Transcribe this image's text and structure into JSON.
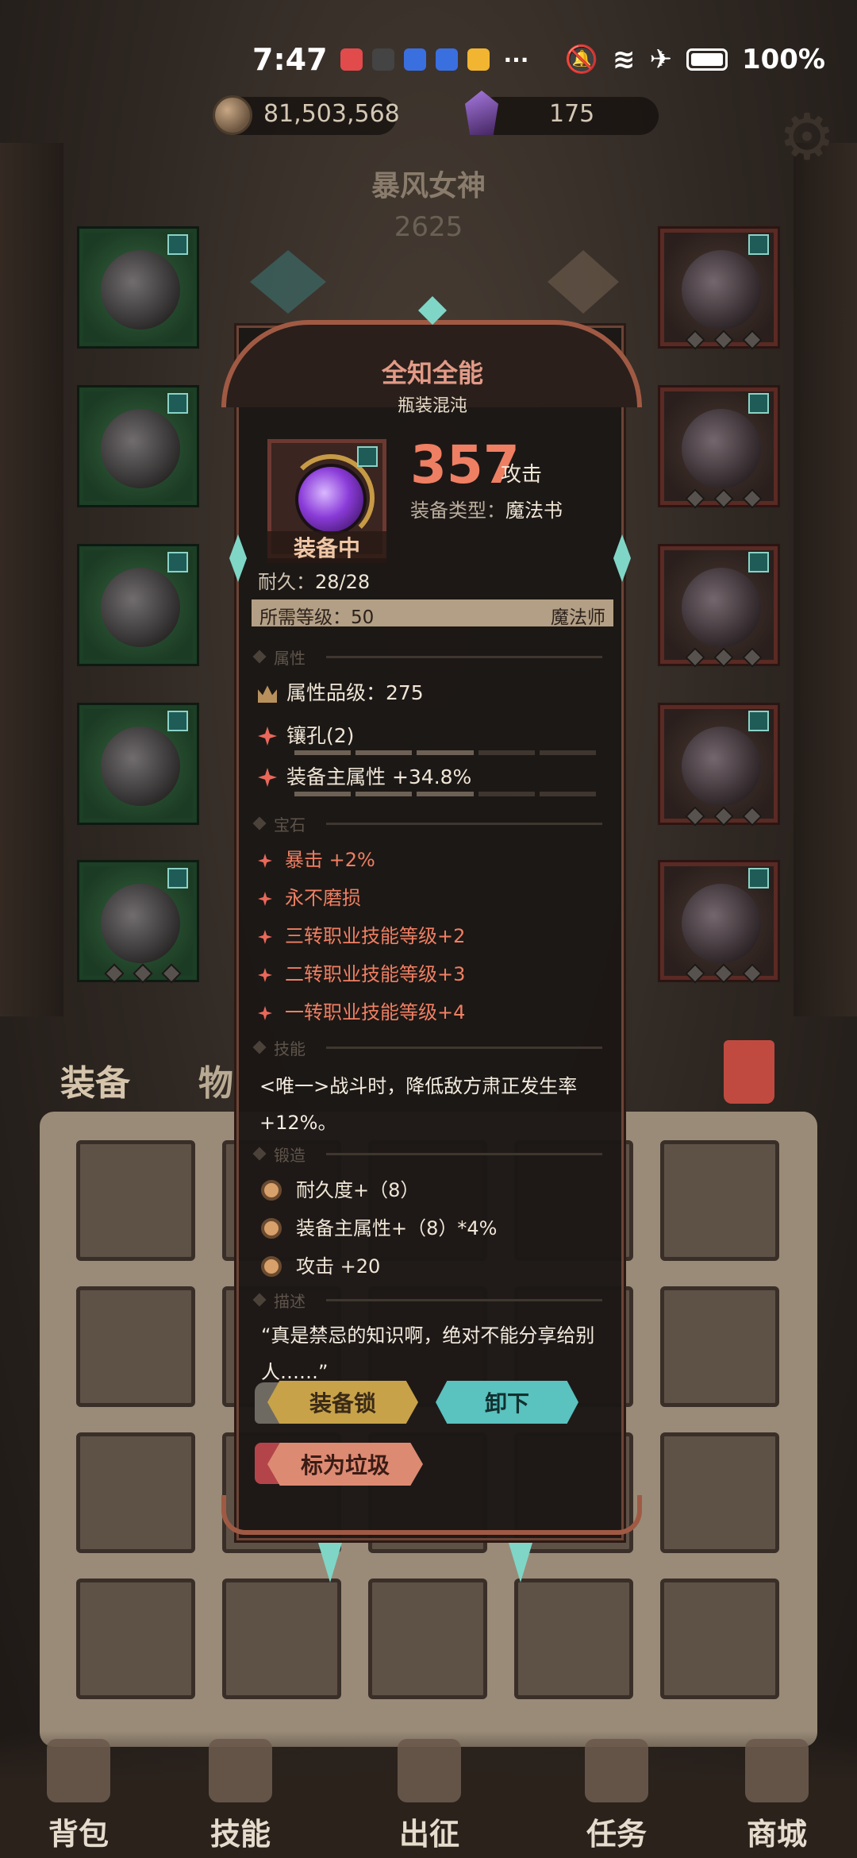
{
  "status_bar": {
    "time": "7:47",
    "dots": "···",
    "battery": "100%"
  },
  "currency": {
    "coins": "81,503,568",
    "gems": "175"
  },
  "hero": {
    "name": "暴风女神",
    "power": "2625"
  },
  "tabs": {
    "equip": "装备",
    "items": "物"
  },
  "tooltip": {
    "title": "全知全能",
    "subtitle": "瓶装混沌",
    "equipped": "装备中",
    "attack_value": "357",
    "attack_label": "攻击",
    "type_label": "装备类型：",
    "type_value": "魔法书",
    "durability_label": "耐久：",
    "durability_value": "28/28",
    "required_level": "所需等级：50",
    "required_class": "魔法师",
    "sections": {
      "attributes": "属性",
      "gems": "宝石",
      "skills": "技能",
      "forge": "锻造",
      "description": "描述"
    },
    "attributes": {
      "grade": "属性品级：275",
      "sockets": "镶孔(2)",
      "main_stat": "装备主属性 +34.8%"
    },
    "gem_bonuses": [
      "暴击 +2%",
      "永不磨损",
      "三转职业技能等级+2",
      "二转职业技能等级+3",
      "一转职业技能等级+4"
    ],
    "skill_text": "<唯一>战斗时，降低敌方肃正发生率+12%。",
    "forge_bonuses": [
      "耐久度+（8）",
      "装备主属性+（8）*4%",
      "攻击 +20"
    ],
    "description": "“真是禁忌的知识啊，绝对不能分享给别人……”",
    "buttons": {
      "lock": "装备锁",
      "unequip": "卸下",
      "junk": "标为垃圾"
    }
  },
  "nav": [
    {
      "label": "背包",
      "icon": "backpack-icon"
    },
    {
      "label": "技能",
      "icon": "skill-book-icon"
    },
    {
      "label": "出征",
      "icon": "sword-icon"
    },
    {
      "label": "任务",
      "icon": "scroll-icon"
    },
    {
      "label": "商城",
      "icon": "shop-icon"
    }
  ],
  "colors": {
    "attack_red": "#ef7f63",
    "gem_red": "#e9685a",
    "teal_accent": "#5ac2bf",
    "gold_button": "#c8a249",
    "panel_border": "#a05a44"
  }
}
